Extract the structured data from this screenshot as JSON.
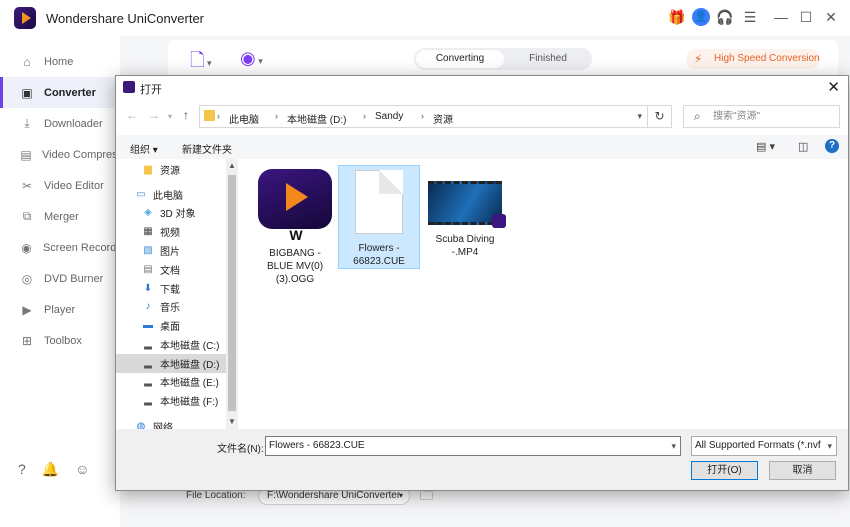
{
  "app": {
    "title": "Wondershare UniConverter",
    "accent": "#6e45e2"
  },
  "sidebar": {
    "items": [
      {
        "label": "Home",
        "icon": "home-icon",
        "glyph": "⌂"
      },
      {
        "label": "Converter",
        "icon": "converter-icon",
        "glyph": "▣"
      },
      {
        "label": "Downloader",
        "icon": "downloader-icon",
        "glyph": "⤓"
      },
      {
        "label": "Video Compressor",
        "icon": "compress-icon",
        "glyph": "▤"
      },
      {
        "label": "Video Editor",
        "icon": "editor-icon",
        "glyph": "✂"
      },
      {
        "label": "Merger",
        "icon": "merger-icon",
        "glyph": "⧉"
      },
      {
        "label": "Screen Recorder",
        "icon": "recorder-icon",
        "glyph": "◉"
      },
      {
        "label": "DVD Burner",
        "icon": "dvd-icon",
        "glyph": "◎"
      },
      {
        "label": "Player",
        "icon": "player-icon",
        "glyph": "▶"
      },
      {
        "label": "Toolbox",
        "icon": "toolbox-icon",
        "glyph": "⊞"
      }
    ],
    "active_index": 1
  },
  "toolbar": {
    "tabs": [
      {
        "label": "Converting"
      },
      {
        "label": "Finished"
      }
    ],
    "high_speed": "High Speed Conversion"
  },
  "footer": {
    "file_location_label": "File Location:",
    "file_location_value": "F:\\Wondershare UniConverter"
  },
  "dialog": {
    "title": "打开",
    "address": [
      "此电脑",
      "本地磁盘 (D:)",
      "Sandy",
      "资源"
    ],
    "search_placeholder": "搜索\"资源\"",
    "organize": "组织 ▾",
    "new_folder": "新建文件夹",
    "tree": [
      {
        "label": "资源",
        "icon": "folder-icon",
        "glyph": "▆",
        "color": "#f5c54a",
        "indent": 1
      },
      {
        "label": "此电脑",
        "icon": "computer-icon",
        "glyph": "▭",
        "color": "#3b8ad8",
        "indent": 0
      },
      {
        "label": "3D 对象",
        "icon": "3d-objects-icon",
        "glyph": "◈",
        "color": "#4aa3e0",
        "indent": 1
      },
      {
        "label": "视频",
        "icon": "videos-icon",
        "glyph": "▦",
        "color": "#444",
        "indent": 1
      },
      {
        "label": "图片",
        "icon": "pictures-icon",
        "glyph": "▧",
        "color": "#3b8ad8",
        "indent": 1
      },
      {
        "label": "文档",
        "icon": "documents-icon",
        "glyph": "▤",
        "color": "#777",
        "indent": 1
      },
      {
        "label": "下载",
        "icon": "downloads-icon",
        "glyph": "⬇",
        "color": "#2b7bd6",
        "indent": 1
      },
      {
        "label": "音乐",
        "icon": "music-icon",
        "glyph": "♪",
        "color": "#2b7bd6",
        "indent": 1
      },
      {
        "label": "桌面",
        "icon": "desktop-icon",
        "glyph": "▬",
        "color": "#2b7bd6",
        "indent": 1
      },
      {
        "label": "本地磁盘 (C:)",
        "icon": "drive-c-icon",
        "glyph": "▂",
        "color": "#555",
        "indent": 1
      },
      {
        "label": "本地磁盘 (D:)",
        "icon": "drive-d-icon",
        "glyph": "▂",
        "color": "#555",
        "indent": 1
      },
      {
        "label": "本地磁盘 (E:)",
        "icon": "drive-e-icon",
        "glyph": "▂",
        "color": "#555",
        "indent": 1
      },
      {
        "label": "本地磁盘 (F:)",
        "icon": "drive-f-icon",
        "glyph": "▂",
        "color": "#555",
        "indent": 1
      },
      {
        "label": "网络",
        "icon": "network-icon",
        "glyph": "◍",
        "color": "#2b7bd6",
        "indent": 0
      }
    ],
    "tree_selected_index": 10,
    "files": [
      {
        "name": "BIGBANG - BLUE MV(0)(3).OGG",
        "line1": "BIGBANG -",
        "line2": "BLUE MV(0)",
        "line3": "(3).OGG",
        "kind": "app"
      },
      {
        "name": "Flowers - 66823.CUE",
        "line1": "Flowers -",
        "line2": "66823.CUE",
        "line3": "",
        "kind": "doc"
      },
      {
        "name": "Scuba Diving -.MP4",
        "line1": "Scuba Diving",
        "line2": "-.MP4",
        "line3": "",
        "kind": "video"
      }
    ],
    "selected_file_index": 1,
    "filename_label": "文件名(N):",
    "filename_value": "Flowers - 66823.CUE",
    "format_value": "All Supported Formats (*.nvf",
    "open_label": "打开(O)",
    "cancel_label": "取消"
  }
}
